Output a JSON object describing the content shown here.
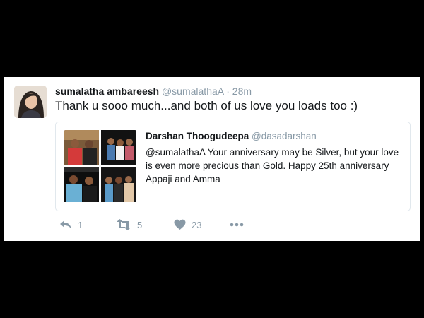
{
  "tweet": {
    "display_name": "sumalatha ambareesh",
    "handle": "@sumalathaA",
    "separator": "·",
    "time": "28m",
    "text": "Thank u sooo much...and  both of us love you loads too :)"
  },
  "quoted": {
    "display_name": "Darshan Thoogudeepa",
    "handle": "@dasadarshan",
    "text": "@sumalathaA  Your anniversary may be Silver, but your love is even more precious than Gold. Happy 25th anniversary Appaji and Amma"
  },
  "actions": {
    "reply_icon": "reply-icon",
    "reply_count": "1",
    "retweet_icon": "retweet-icon",
    "retweet_count": "5",
    "like_icon": "heart-icon",
    "like_count": "23",
    "more_icon": "more-icon"
  },
  "colors": {
    "background": "#000000",
    "card": "#ffffff",
    "text": "#14171a",
    "muted": "#8899a6",
    "border": "#e1e8ed"
  }
}
